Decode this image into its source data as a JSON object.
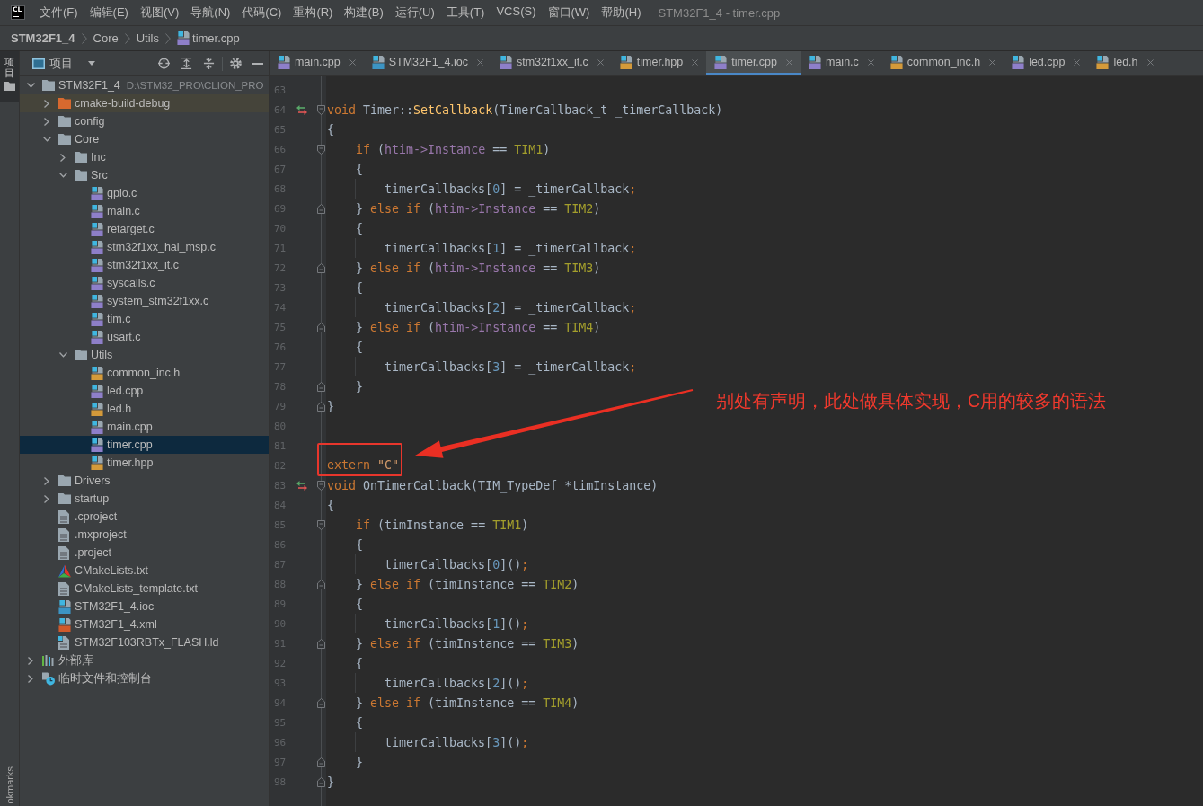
{
  "menu_bar": {
    "logo": "CL",
    "items": [
      "文件(F)",
      "编辑(E)",
      "视图(V)",
      "导航(N)",
      "代码(C)",
      "重构(R)",
      "构建(B)",
      "运行(U)",
      "工具(T)",
      "VCS(S)",
      "窗口(W)",
      "帮助(H)"
    ],
    "title": "STM32F1_4 - timer.cpp"
  },
  "breadcrumb": [
    {
      "label": "STM32F1_4",
      "kind": "project"
    },
    {
      "label": "Core",
      "kind": "folder"
    },
    {
      "label": "Utils",
      "kind": "folder"
    },
    {
      "label": "timer.cpp",
      "kind": "cpp"
    }
  ],
  "tool_strip": {
    "top": [
      {
        "label": "项目",
        "selected": true
      }
    ],
    "bottom": [
      {
        "label": "okmarks",
        "selected": false
      }
    ]
  },
  "project_panel": {
    "title": "项目",
    "tree": [
      {
        "name": "STM32F1_4",
        "path": "D:\\STM32_PRO\\CLION_PRO",
        "kind": "folder",
        "expanded": true,
        "selected": false,
        "children": [
          {
            "name": "cmake-build-debug",
            "kind": "excluded-folder",
            "expanded": false,
            "selected": false
          },
          {
            "name": "config",
            "kind": "folder",
            "expanded": false,
            "selected": false
          },
          {
            "name": "Core",
            "kind": "folder",
            "expanded": true,
            "selected": false,
            "children": [
              {
                "name": "Inc",
                "kind": "folder",
                "expanded": false,
                "selected": false
              },
              {
                "name": "Src",
                "kind": "folder",
                "expanded": true,
                "selected": false,
                "children": [
                  {
                    "name": "gpio.c",
                    "kind": "c",
                    "selected": false
                  },
                  {
                    "name": "main.c",
                    "kind": "c",
                    "selected": false
                  },
                  {
                    "name": "retarget.c",
                    "kind": "c",
                    "selected": false
                  },
                  {
                    "name": "stm32f1xx_hal_msp.c",
                    "kind": "c",
                    "selected": false
                  },
                  {
                    "name": "stm32f1xx_it.c",
                    "kind": "c",
                    "selected": false
                  },
                  {
                    "name": "syscalls.c",
                    "kind": "c",
                    "selected": false
                  },
                  {
                    "name": "system_stm32f1xx.c",
                    "kind": "c",
                    "selected": false
                  },
                  {
                    "name": "tim.c",
                    "kind": "c",
                    "selected": false
                  },
                  {
                    "name": "usart.c",
                    "kind": "c",
                    "selected": false
                  }
                ]
              },
              {
                "name": "Utils",
                "kind": "folder",
                "expanded": true,
                "selected": false,
                "children": [
                  {
                    "name": "common_inc.h",
                    "kind": "h",
                    "selected": false
                  },
                  {
                    "name": "led.cpp",
                    "kind": "cpp",
                    "selected": false
                  },
                  {
                    "name": "led.h",
                    "kind": "h",
                    "selected": false
                  },
                  {
                    "name": "main.cpp",
                    "kind": "cpp",
                    "selected": false
                  },
                  {
                    "name": "timer.cpp",
                    "kind": "cpp",
                    "selected": true
                  },
                  {
                    "name": "timer.hpp",
                    "kind": "h",
                    "selected": false
                  }
                ]
              }
            ]
          },
          {
            "name": "Drivers",
            "kind": "folder",
            "expanded": false,
            "selected": false
          },
          {
            "name": "startup",
            "kind": "folder",
            "expanded": false,
            "selected": false
          },
          {
            "name": ".cproject",
            "kind": "text",
            "selected": false
          },
          {
            "name": ".mxproject",
            "kind": "text",
            "selected": false
          },
          {
            "name": ".project",
            "kind": "text",
            "selected": false
          },
          {
            "name": "CMakeLists.txt",
            "kind": "cmake",
            "selected": false
          },
          {
            "name": "CMakeLists_template.txt",
            "kind": "text",
            "selected": false
          },
          {
            "name": "STM32F1_4.ioc",
            "kind": "ioc",
            "selected": false
          },
          {
            "name": "STM32F1_4.xml",
            "kind": "xml",
            "selected": false
          },
          {
            "name": "STM32F103RBTx_FLASH.ld",
            "kind": "linker",
            "selected": false
          }
        ]
      },
      {
        "name": "外部库",
        "kind": "libraries",
        "expanded": false,
        "selected": false
      },
      {
        "name": "临时文件和控制台",
        "kind": "scratches",
        "expanded": false,
        "selected": false
      }
    ]
  },
  "editor_tabs": [
    {
      "label": "main.cpp",
      "kind": "cpp",
      "selected": false
    },
    {
      "label": "STM32F1_4.ioc",
      "kind": "ioc",
      "selected": false
    },
    {
      "label": "stm32f1xx_it.c",
      "kind": "c",
      "selected": false
    },
    {
      "label": "timer.hpp",
      "kind": "h",
      "selected": false
    },
    {
      "label": "timer.cpp",
      "kind": "cpp",
      "selected": true
    },
    {
      "label": "main.c",
      "kind": "c",
      "selected": false
    },
    {
      "label": "common_inc.h",
      "kind": "h",
      "selected": false
    },
    {
      "label": "led.cpp",
      "kind": "cpp",
      "selected": false
    },
    {
      "label": "led.h",
      "kind": "h",
      "selected": false
    }
  ],
  "editor": {
    "lines": [
      {
        "number": "63",
        "highlighted": false
      },
      {
        "number": "64",
        "highlighted": false,
        "gutter_icons": [
          {
            "kind": "implements"
          },
          {
            "kind": "fold-start"
          }
        ],
        "tokens": [
          {
            "text": "void",
            "kind": "keyword"
          },
          {
            "text": " Timer::",
            "kind": "plain"
          },
          {
            "text": "SetCallback",
            "kind": "function"
          },
          {
            "text": "(TimerCallback_t _timerCallback)",
            "kind": "plain"
          }
        ]
      },
      {
        "number": "65",
        "highlighted": false,
        "tokens": [
          {
            "text": "{",
            "kind": "plain"
          }
        ]
      },
      {
        "number": "66",
        "highlighted": false,
        "gutter_icons": [
          {
            "kind": "fold-start"
          }
        ],
        "tokens": [
          {
            "text": "    if",
            "kind": "keyword"
          },
          {
            "text": " (",
            "kind": "plain"
          },
          {
            "text": "htim->Instance",
            "kind": "field"
          },
          {
            "text": " == ",
            "kind": "plain"
          },
          {
            "text": "TIM1",
            "kind": "macro"
          },
          {
            "text": ")",
            "kind": "plain"
          }
        ]
      },
      {
        "number": "67",
        "highlighted": false,
        "tokens": [
          {
            "text": "    {",
            "kind": "plain"
          }
        ]
      },
      {
        "number": "68",
        "highlighted": false,
        "tokens": [
          {
            "text": "        timerCallbacks[",
            "kind": "plain"
          },
          {
            "text": "0",
            "kind": "number"
          },
          {
            "text": "] = _timerCallback",
            "kind": "plain"
          },
          {
            "text": ";",
            "kind": "punct"
          }
        ]
      },
      {
        "number": "69",
        "highlighted": false,
        "gutter_icons": [
          {
            "kind": "fold-end"
          }
        ],
        "tokens": [
          {
            "text": "    } ",
            "kind": "plain"
          },
          {
            "text": "else if",
            "kind": "keyword"
          },
          {
            "text": " (",
            "kind": "plain"
          },
          {
            "text": "htim->Instance",
            "kind": "field"
          },
          {
            "text": " == ",
            "kind": "plain"
          },
          {
            "text": "TIM2",
            "kind": "macro"
          },
          {
            "text": ")",
            "kind": "plain"
          }
        ]
      },
      {
        "number": "70",
        "highlighted": false,
        "tokens": [
          {
            "text": "    {",
            "kind": "plain"
          }
        ]
      },
      {
        "number": "71",
        "highlighted": false,
        "tokens": [
          {
            "text": "        timerCallbacks[",
            "kind": "plain"
          },
          {
            "text": "1",
            "kind": "number"
          },
          {
            "text": "] = _timerCallback",
            "kind": "plain"
          },
          {
            "text": ";",
            "kind": "punct"
          }
        ]
      },
      {
        "number": "72",
        "highlighted": false,
        "gutter_icons": [
          {
            "kind": "fold-end"
          }
        ],
        "tokens": [
          {
            "text": "    } ",
            "kind": "plain"
          },
          {
            "text": "else if",
            "kind": "keyword"
          },
          {
            "text": " (",
            "kind": "plain"
          },
          {
            "text": "htim->Instance",
            "kind": "field"
          },
          {
            "text": " == ",
            "kind": "plain"
          },
          {
            "text": "TIM3",
            "kind": "macro"
          },
          {
            "text": ")",
            "kind": "plain"
          }
        ]
      },
      {
        "number": "73",
        "highlighted": false,
        "tokens": [
          {
            "text": "    {",
            "kind": "plain"
          }
        ]
      },
      {
        "number": "74",
        "highlighted": false,
        "tokens": [
          {
            "text": "        timerCallbacks[",
            "kind": "plain"
          },
          {
            "text": "2",
            "kind": "number"
          },
          {
            "text": "] = _timerCallback",
            "kind": "plain"
          },
          {
            "text": ";",
            "kind": "punct"
          }
        ]
      },
      {
        "number": "75",
        "highlighted": false,
        "gutter_icons": [
          {
            "kind": "fold-end"
          }
        ],
        "tokens": [
          {
            "text": "    } ",
            "kind": "plain"
          },
          {
            "text": "else if",
            "kind": "keyword"
          },
          {
            "text": " (",
            "kind": "plain"
          },
          {
            "text": "htim->Instance",
            "kind": "field"
          },
          {
            "text": " == ",
            "kind": "plain"
          },
          {
            "text": "TIM4",
            "kind": "macro"
          },
          {
            "text": ")",
            "kind": "plain"
          }
        ]
      },
      {
        "number": "76",
        "highlighted": false,
        "tokens": [
          {
            "text": "    {",
            "kind": "plain"
          }
        ]
      },
      {
        "number": "77",
        "highlighted": false,
        "tokens": [
          {
            "text": "        timerCallbacks[",
            "kind": "plain"
          },
          {
            "text": "3",
            "kind": "number"
          },
          {
            "text": "] = _timerCallback",
            "kind": "plain"
          },
          {
            "text": ";",
            "kind": "punct"
          }
        ]
      },
      {
        "number": "78",
        "highlighted": false,
        "gutter_icons": [
          {
            "kind": "fold-end"
          }
        ],
        "tokens": [
          {
            "text": "    }",
            "kind": "plain"
          }
        ]
      },
      {
        "number": "79",
        "highlighted": false,
        "gutter_icons": [
          {
            "kind": "fold-end"
          }
        ],
        "tokens": [
          {
            "text": "}",
            "kind": "plain"
          }
        ]
      },
      {
        "number": "80",
        "highlighted": false
      },
      {
        "number": "81",
        "highlighted": false
      },
      {
        "number": "82",
        "highlighted": true,
        "tokens": [
          {
            "text": "extern",
            "kind": "keyword"
          },
          {
            "text": " \"C\"",
            "kind": "string"
          }
        ]
      },
      {
        "number": "83",
        "highlighted": false,
        "gutter_icons": [
          {
            "kind": "implements"
          },
          {
            "kind": "fold-start"
          }
        ],
        "tokens": [
          {
            "text": "void",
            "kind": "keyword"
          },
          {
            "text": " OnTimerCallback(TIM_TypeDef *timInstance)",
            "kind": "plain"
          }
        ]
      },
      {
        "number": "84",
        "highlighted": false,
        "tokens": [
          {
            "text": "{",
            "kind": "plain"
          }
        ]
      },
      {
        "number": "85",
        "highlighted": false,
        "gutter_icons": [
          {
            "kind": "fold-start"
          }
        ],
        "tokens": [
          {
            "text": "    if",
            "kind": "keyword"
          },
          {
            "text": " (timInstance == ",
            "kind": "plain"
          },
          {
            "text": "TIM1",
            "kind": "macro"
          },
          {
            "text": ")",
            "kind": "plain"
          }
        ]
      },
      {
        "number": "86",
        "highlighted": false,
        "tokens": [
          {
            "text": "    {",
            "kind": "plain"
          }
        ]
      },
      {
        "number": "87",
        "highlighted": false,
        "tokens": [
          {
            "text": "        timerCallbacks[",
            "kind": "plain"
          },
          {
            "text": "0",
            "kind": "number"
          },
          {
            "text": "]()",
            "kind": "plain"
          },
          {
            "text": ";",
            "kind": "punct"
          }
        ]
      },
      {
        "number": "88",
        "highlighted": false,
        "gutter_icons": [
          {
            "kind": "fold-end"
          }
        ],
        "tokens": [
          {
            "text": "    } ",
            "kind": "plain"
          },
          {
            "text": "else if",
            "kind": "keyword"
          },
          {
            "text": " (timInstance == ",
            "kind": "plain"
          },
          {
            "text": "TIM2",
            "kind": "macro"
          },
          {
            "text": ")",
            "kind": "plain"
          }
        ]
      },
      {
        "number": "89",
        "highlighted": false,
        "tokens": [
          {
            "text": "    {",
            "kind": "plain"
          }
        ]
      },
      {
        "number": "90",
        "highlighted": false,
        "tokens": [
          {
            "text": "        timerCallbacks[",
            "kind": "plain"
          },
          {
            "text": "1",
            "kind": "number"
          },
          {
            "text": "]()",
            "kind": "plain"
          },
          {
            "text": ";",
            "kind": "punct"
          }
        ]
      },
      {
        "number": "91",
        "highlighted": false,
        "gutter_icons": [
          {
            "kind": "fold-end"
          }
        ],
        "tokens": [
          {
            "text": "    } ",
            "kind": "plain"
          },
          {
            "text": "else if",
            "kind": "keyword"
          },
          {
            "text": " (timInstance == ",
            "kind": "plain"
          },
          {
            "text": "TIM3",
            "kind": "macro"
          },
          {
            "text": ")",
            "kind": "plain"
          }
        ]
      },
      {
        "number": "92",
        "highlighted": false,
        "tokens": [
          {
            "text": "    {",
            "kind": "plain"
          }
        ]
      },
      {
        "number": "93",
        "highlighted": false,
        "tokens": [
          {
            "text": "        timerCallbacks[",
            "kind": "plain"
          },
          {
            "text": "2",
            "kind": "number"
          },
          {
            "text": "]()",
            "kind": "plain"
          },
          {
            "text": ";",
            "kind": "punct"
          }
        ]
      },
      {
        "number": "94",
        "highlighted": false,
        "gutter_icons": [
          {
            "kind": "fold-end"
          }
        ],
        "tokens": [
          {
            "text": "    } ",
            "kind": "plain"
          },
          {
            "text": "else if",
            "kind": "keyword"
          },
          {
            "text": " (timInstance == ",
            "kind": "plain"
          },
          {
            "text": "TIM4",
            "kind": "macro"
          },
          {
            "text": ")",
            "kind": "plain"
          }
        ]
      },
      {
        "number": "95",
        "highlighted": false,
        "tokens": [
          {
            "text": "    {",
            "kind": "plain"
          }
        ]
      },
      {
        "number": "96",
        "highlighted": false,
        "tokens": [
          {
            "text": "        timerCallbacks[",
            "kind": "plain"
          },
          {
            "text": "3",
            "kind": "number"
          },
          {
            "text": "]()",
            "kind": "plain"
          },
          {
            "text": ";",
            "kind": "punct"
          }
        ]
      },
      {
        "number": "97",
        "highlighted": false,
        "gutter_icons": [
          {
            "kind": "fold-end"
          }
        ],
        "tokens": [
          {
            "text": "    }",
            "kind": "plain"
          }
        ]
      },
      {
        "number": "98",
        "highlighted": false,
        "gutter_icons": [
          {
            "kind": "fold-end"
          }
        ],
        "tokens": [
          {
            "text": "}",
            "kind": "plain"
          }
        ]
      }
    ]
  },
  "annotation": {
    "text": "别处有声明，此处做具体实现，C用的较多的语法"
  }
}
